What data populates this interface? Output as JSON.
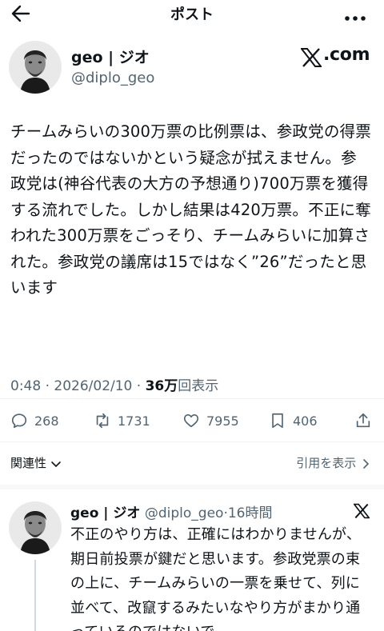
{
  "header": {
    "title": "ポスト"
  },
  "author": {
    "name": "geo | ジオ",
    "handle": "@diplo_geo",
    "site": ".com"
  },
  "post": {
    "text": "チームみらいの300万票の比例票は、参政党の得票だったのではないかという疑念が拭えません。参政党は(神谷代表の大方の予想通り)700万票を獲得する流れでした。しかし結果は420万票。不正に奪われた300万票をごっそり、チームみらいに加算された。参政党の議席は15ではなく”26”だったと思います",
    "time": "0:48 · 2026/02/10 · ",
    "views_count": "36万",
    "views_label": "回表示"
  },
  "actions": {
    "replies": "268",
    "reposts": "1731",
    "likes": "7955",
    "bookmarks": "406"
  },
  "links": {
    "related": "関連性",
    "quotes": "引用を表示"
  },
  "reply": {
    "name": "geo | ジオ",
    "handle": "@diplo_geo",
    "time": "·16時間",
    "text": "不正のやり方は、正確にはわかりませんが、期日前投票が鍵だと思います。参政党票の束の上に、チームみらいの一票を乗せて、列に並べて、改竄するみたいなやり方がまかり通っているのではないで"
  }
}
